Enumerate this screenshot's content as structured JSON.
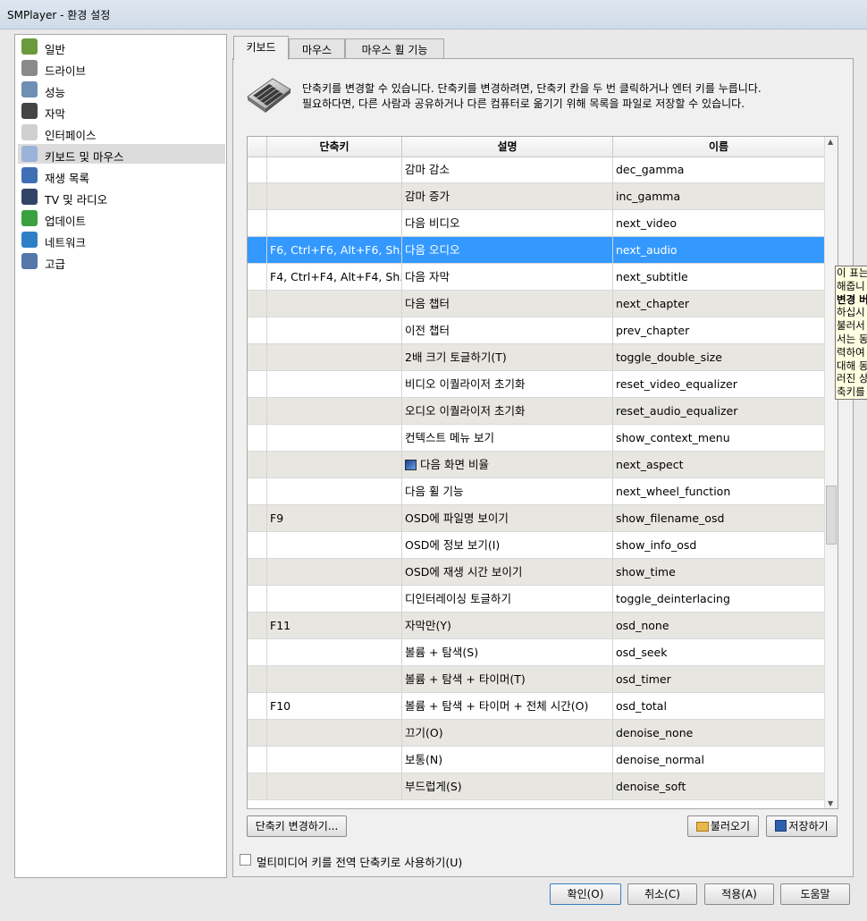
{
  "window": {
    "title": "SMPlayer - 환경 설정"
  },
  "sidebar": {
    "items": [
      {
        "label": "일반",
        "icon": "general-icon",
        "color": "#6a9a3c",
        "selected": false
      },
      {
        "label": "드라이브",
        "icon": "drive-icon",
        "color": "#8a8a8a",
        "selected": false
      },
      {
        "label": "성능",
        "icon": "performance-gear-icon",
        "color": "#6f8fb3",
        "selected": false
      },
      {
        "label": "자막",
        "icon": "subtitles-letter-a-icon",
        "color": "#444444",
        "selected": false
      },
      {
        "label": "인터페이스",
        "icon": "interface-window-icon",
        "color": "#d0d0d0",
        "selected": false
      },
      {
        "label": "키보드 및 마우스",
        "icon": "keyboard-mouse-icon",
        "color": "#9bb3d8",
        "selected": true
      },
      {
        "label": "재생 목록",
        "icon": "playlist-icon",
        "color": "#3f6fb5",
        "selected": false
      },
      {
        "label": "TV 및 라디오",
        "icon": "tv-icon",
        "color": "#334466",
        "selected": false
      },
      {
        "label": "업데이트",
        "icon": "update-arrows-icon",
        "color": "#3aa040",
        "selected": false
      },
      {
        "label": "네트워크",
        "icon": "network-globe-icon",
        "color": "#2f7fc7",
        "selected": false
      },
      {
        "label": "고급",
        "icon": "advanced-monitor-icon",
        "color": "#5577aa",
        "selected": false
      }
    ]
  },
  "tabs": [
    {
      "label": "키보드",
      "active": true
    },
    {
      "label": "마우스",
      "active": false
    },
    {
      "label": "마우스 휠 기능",
      "active": false
    }
  ],
  "description": {
    "line1": "단축키를 변경할 수 있습니다. 단축키를 변경하려면, 단축키 칸을 두 번 클릭하거나 엔터 키를 누릅니다.",
    "line2": "필요하다면, 다른 사람과 공유하거나 다른 컴퓨터로 옮기기 위해 목록을 파일로 저장할 수 있습니다."
  },
  "table": {
    "headers": [
      "단축키",
      "설명",
      "이름"
    ],
    "rows": [
      {
        "shortcut": "",
        "desc": "감마 감소",
        "name": "dec_gamma"
      },
      {
        "shortcut": "",
        "desc": "감마 증가",
        "name": "inc_gamma"
      },
      {
        "shortcut": "",
        "desc": "다음 비디오",
        "name": "next_video"
      },
      {
        "shortcut": "F6, Ctrl+F6, Alt+F6, Sh...",
        "desc": "다음 오디오",
        "name": "next_audio",
        "selected": true
      },
      {
        "shortcut": "F4, Ctrl+F4, Alt+F4, Sh...",
        "desc": "다음 자막",
        "name": "next_subtitle"
      },
      {
        "shortcut": "",
        "desc": "다음 챕터",
        "name": "next_chapter"
      },
      {
        "shortcut": "",
        "desc": "이전 챕터",
        "name": "prev_chapter"
      },
      {
        "shortcut": "",
        "desc": "2배 크기 토글하기(T)",
        "name": "toggle_double_size"
      },
      {
        "shortcut": "",
        "desc": "비디오 이퀄라이저 초기화",
        "name": "reset_video_equalizer"
      },
      {
        "shortcut": "",
        "desc": "오디오 이퀄라이저 초기화",
        "name": "reset_audio_equalizer"
      },
      {
        "shortcut": "",
        "desc": "컨텍스트 메뉴 보기",
        "name": "show_context_menu"
      },
      {
        "shortcut": "",
        "desc": "다음 화면 비율",
        "name": "next_aspect",
        "icon": "aspect-ratio-icon"
      },
      {
        "shortcut": "",
        "desc": "다음 휠 기능",
        "name": "next_wheel_function"
      },
      {
        "shortcut": "F9",
        "desc": "OSD에 파일명 보이기",
        "name": "show_filename_osd"
      },
      {
        "shortcut": "",
        "desc": "OSD에 정보 보기(I)",
        "name": "show_info_osd"
      },
      {
        "shortcut": "",
        "desc": "OSD에 재생 시간 보이기",
        "name": "show_time"
      },
      {
        "shortcut": "",
        "desc": "디인터레이싱 토글하기",
        "name": "toggle_deinterlacing"
      },
      {
        "shortcut": "F11",
        "desc": "자막만(Y)",
        "name": "osd_none"
      },
      {
        "shortcut": "",
        "desc": "볼륨 + 탐색(S)",
        "name": "osd_seek"
      },
      {
        "shortcut": "",
        "desc": "볼륨 + 탐색 + 타이머(T)",
        "name": "osd_timer"
      },
      {
        "shortcut": "F10",
        "desc": "볼륨 + 탐색 + 타이머 + 전체 시간(O)",
        "name": "osd_total"
      },
      {
        "shortcut": "",
        "desc": "끄기(O)",
        "name": "denoise_none"
      },
      {
        "shortcut": "",
        "desc": "보통(N)",
        "name": "denoise_normal"
      },
      {
        "shortcut": "",
        "desc": "부드럽게(S)",
        "name": "denoise_soft"
      }
    ]
  },
  "buttons": {
    "change_shortcut": "단축키 변경하기...",
    "load": "불러오기",
    "save": "저장하기",
    "ok": "확인(O)",
    "cancel": "취소(C)",
    "apply": "적용(A)",
    "help": "도움말"
  },
  "checkbox": {
    "label": "멀티미디어 키를 전역 단축키로 사용하기(U)",
    "checked": false
  },
  "tooltip": {
    "lines": [
      "이 표는",
      "해줍니",
      "변경 버",
      "하십시",
      "불러서",
      "서는 동",
      "력하여",
      "대해 동",
      "러진 상",
      "축키를"
    ]
  },
  "colors": {
    "selection": "#3399ff",
    "alt_row": "#e8e6e1",
    "tooltip_bg": "#ffffe1"
  }
}
